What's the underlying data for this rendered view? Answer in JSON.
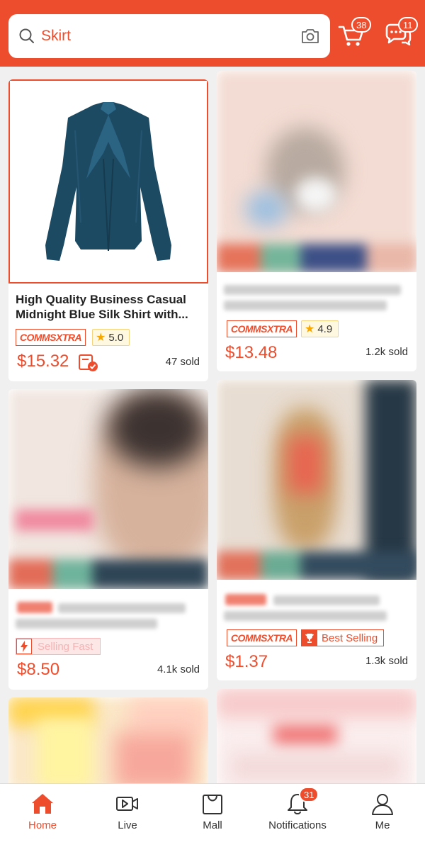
{
  "search": {
    "query": "Skirt"
  },
  "header": {
    "cart_count": "38",
    "chat_count": "11"
  },
  "products": [
    {
      "title": "High Quality Business Casual Midnight Blue Silk Shirt with...",
      "badge": "COMMSXTRA",
      "rating": "5.0",
      "price": "$15.32",
      "sold": "47 sold"
    },
    {
      "badge": "COMMSXTRA",
      "rating": "4.9",
      "price": "$13.48",
      "sold": "1.2k sold"
    },
    {
      "tag": "Selling Fast",
      "price": "$8.50",
      "sold": "4.1k sold"
    },
    {
      "badge": "COMMSXTRA",
      "tag": "Best Selling",
      "price": "$1.37",
      "sold": "1.3k sold"
    }
  ],
  "nav": {
    "home": "Home",
    "live": "Live",
    "mall": "Mall",
    "notifications": "Notifications",
    "notifications_count": "31",
    "me": "Me"
  },
  "colors": {
    "brand": "#ee4d2d"
  }
}
